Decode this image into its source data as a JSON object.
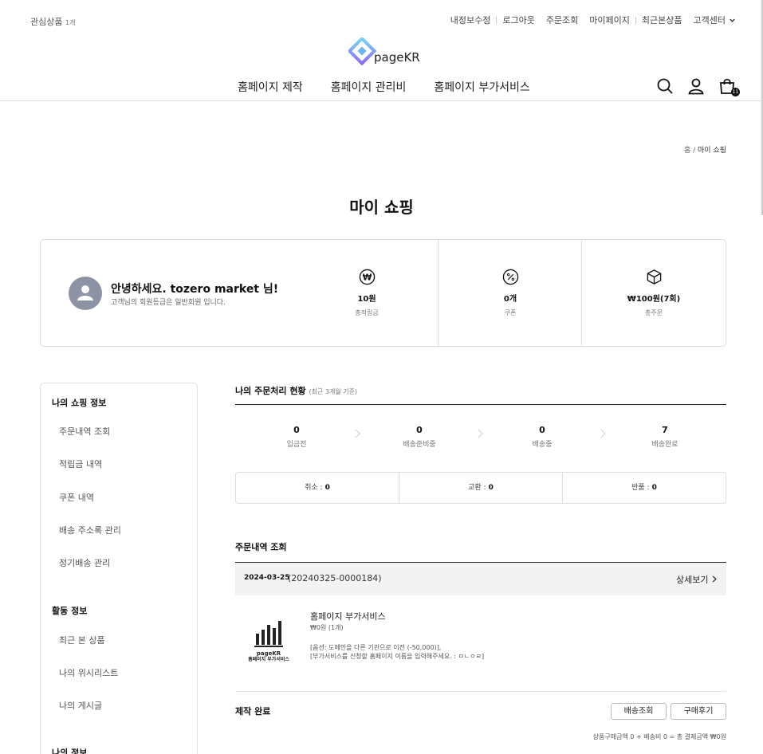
{
  "topbar": {
    "wishlist_label": "관심상품",
    "wishlist_count": "1개",
    "nav": [
      "내정보수정",
      "로그아웃",
      "주문조회",
      "마이페이지",
      "최근본상품",
      "고객센터"
    ]
  },
  "logo": {
    "text": "pageKR"
  },
  "gnb": [
    "홈페이지 제작",
    "홈페이지 관리비",
    "홈페이지 부가서비스"
  ],
  "cart": {
    "count": "11"
  },
  "breadcrumb": {
    "home": "홈",
    "sep": "/",
    "current": "마이 쇼핑"
  },
  "page_title": "마이 쇼핑",
  "summary": {
    "greeting": "안녕하세요. tozero market 님!",
    "grade_text": "고객님의 회원등급은 일반회원 입니다.",
    "stats": [
      {
        "icon": "won-icon",
        "value": "10원",
        "label": "총적립금"
      },
      {
        "icon": "percent-icon",
        "value": "0개",
        "label": "쿠폰"
      },
      {
        "icon": "box-icon",
        "value": "₩100원(7회)",
        "label": "총주문"
      }
    ]
  },
  "sidebar": {
    "sections": [
      {
        "title": "나의 쇼핑 정보",
        "items": [
          "주문내역 조회",
          "적립금 내역",
          "쿠폰 내역",
          "배송 주소록 관리",
          "정기배송 관리"
        ]
      },
      {
        "title": "활동 정보",
        "items": [
          "최근 본 상품",
          "나의 위시리스트",
          "나의 게시글"
        ]
      },
      {
        "title": "나의 정보",
        "items": []
      }
    ]
  },
  "order_status": {
    "title": "나의 주문처리 현황",
    "subtitle": "(최근 3개월 기준)",
    "steps": [
      {
        "count": "0",
        "label": "입금전"
      },
      {
        "count": "0",
        "label": "배송준비중"
      },
      {
        "count": "0",
        "label": "배송중"
      },
      {
        "count": "7",
        "label": "배송완료"
      }
    ],
    "cancel": [
      {
        "label": "취소 :",
        "value": "0"
      },
      {
        "label": "교환 :",
        "value": "0"
      },
      {
        "label": "반품 :",
        "value": "0"
      }
    ]
  },
  "order_history": {
    "title": "주문내역 조회",
    "date": "2024-03-25",
    "order_no": "(20240325-0000184)",
    "detail_label": "상세보기",
    "product": {
      "thumb_brand": "pageKR",
      "thumb_caption": "홈페이지 부가서비스",
      "name": "홈페이지 부가서비스",
      "price": "₩0원 (1개)",
      "option1": "[옵션: 도메인을 다른 기관으로 이전 (-50,000)],",
      "option2": "[부가서비스를 신청할 홈페이지 이름을 입력해주세요. : ㅁㄴㅇㄹ]"
    },
    "status": "제작 완료",
    "buttons": [
      "배송조회",
      "구매후기"
    ],
    "totals": "상품구매금액 0 + 배송비 0 =  총 결제금액 ₩0원"
  }
}
